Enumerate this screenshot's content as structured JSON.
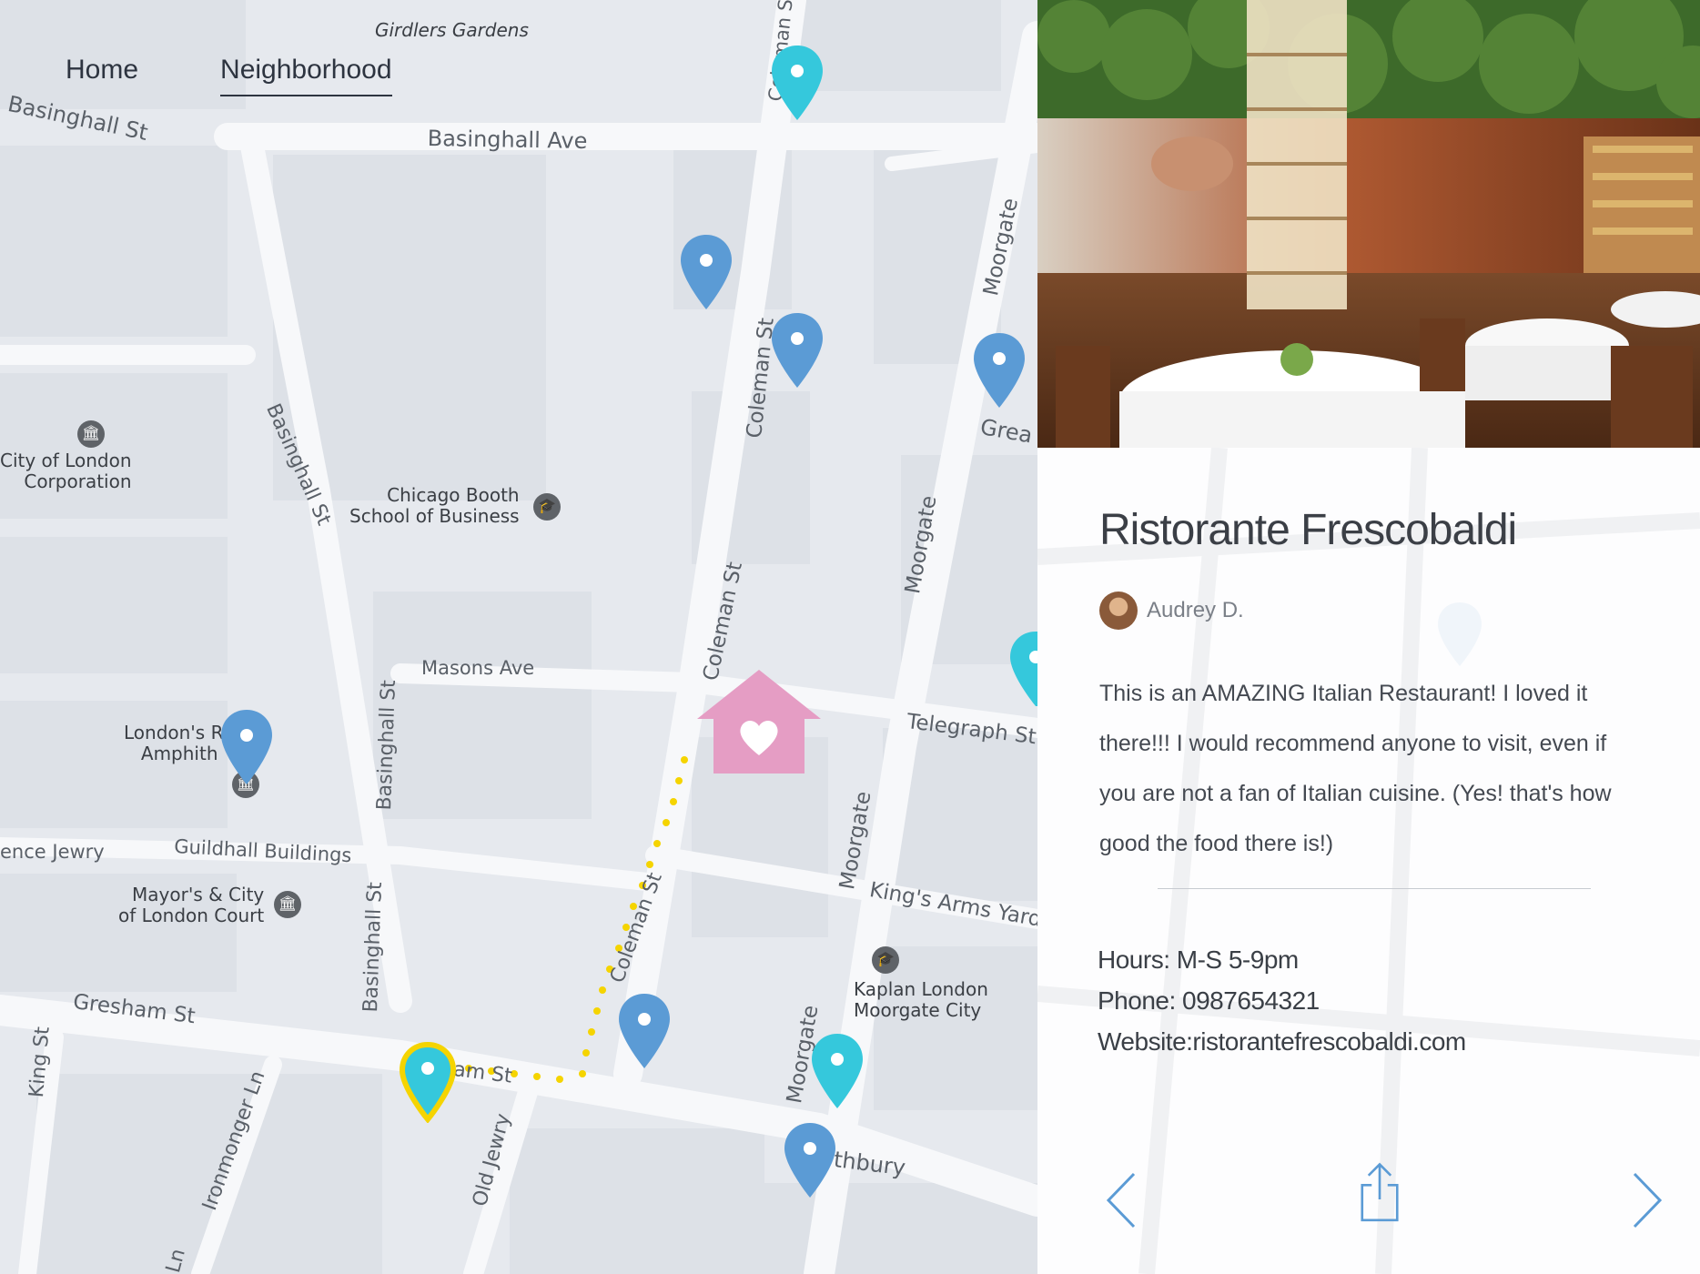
{
  "nav": {
    "home": "Home",
    "neighborhood": "Neighborhood"
  },
  "map": {
    "streets": {
      "basinghall_st_top": "Basinghall St",
      "basinghall_ave": "Basinghall Ave",
      "girdlers_gardens": "Girdlers Gardens",
      "coleman_st_top": "Coleman St",
      "coleman_st_mid": "Coleman St",
      "coleman_st_low": "Coleman St",
      "coleman_st_path": "Coleman St",
      "moorgate_top": "Moorgate",
      "moorgate_mid": "Moorgate",
      "moorgate_low": "Moorgate",
      "moorgate_bottom": "Moorgate",
      "basinghall_st_diag": "Basinghall St",
      "basinghall_st_v1": "Basinghall St",
      "basinghall_st_v2": "Basinghall St",
      "masons_ave": "Masons Ave",
      "telegraph_st": "Telegraph St",
      "guildhall_buildings": "Guildhall Buildings",
      "kings_arms_yard": "King's Arms Yard",
      "gresham_st": "Gresham St",
      "gresham_st_partial": "am St",
      "lothbury": "thbury",
      "old_jewry": "Old Jewry",
      "ironmonger_ln": "Ironmonger Ln",
      "king_st": "King St",
      "great_partial": "Grea",
      "jewry_partial": "ence Jewry",
      "ln_partial": "Ln"
    },
    "pois": {
      "city_of_london": "City of London\nCorporation",
      "chicago_booth": "Chicago Booth\nSchool of Business",
      "london_amphitheatre": "London's R     n\nAmphith      e",
      "mayors_court": "Mayor's & City\nof London Court",
      "kaplan": "Kaplan London\nMoorgate City"
    }
  },
  "restaurant": {
    "name": "Ristorante Frescobaldi",
    "author": "Audrey D.",
    "review": "This is an AMAZING Italian Restaurant! I loved it there!!! I would recommend anyone to visit, even if you are not a fan of Italian cuisine. (Yes! that's how good the food there is!)",
    "hours": "Hours: M-S 5-9pm",
    "phone": "Phone: 0987654321",
    "website_label": "Website:",
    "website": "ristorantefrescobaldi.com"
  },
  "colors": {
    "pin_blue": "#5b9bd5",
    "pin_cyan": "#35c8dc",
    "pin_yellow": "#f5d400",
    "home_pink": "#e59dc4",
    "route_dots": "#f5d400"
  },
  "icons": [
    "map-pin-icon",
    "home-heart-icon",
    "museum-icon",
    "school-icon",
    "chevron-left-icon",
    "share-icon",
    "chevron-right-icon"
  ]
}
